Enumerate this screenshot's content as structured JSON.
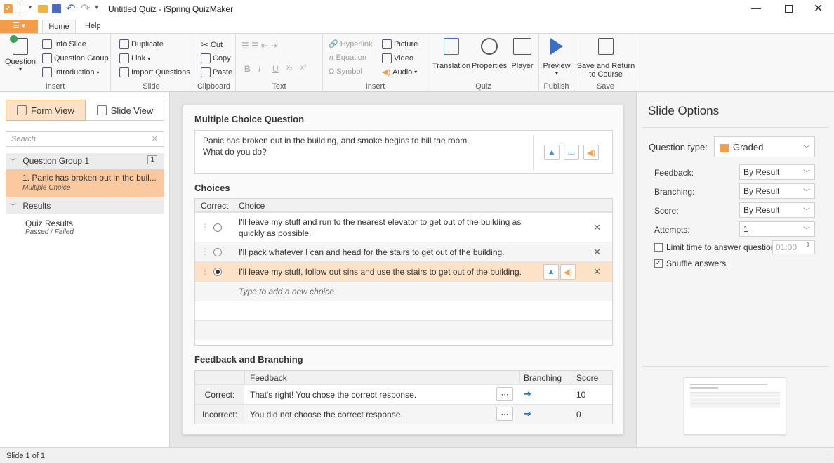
{
  "window": {
    "title": "Untitled Quiz - iSpring QuizMaker"
  },
  "ribbon_tabs": {
    "file_menu": "☰ ▾",
    "home": "Home",
    "help": "Help"
  },
  "ribbon": {
    "insert": {
      "question": "Question",
      "info_slide": "Info Slide",
      "question_group": "Question Group",
      "introduction": "Introduction",
      "label": "Insert"
    },
    "slide": {
      "duplicate": "Duplicate",
      "link": "Link",
      "import_questions": "Import Questions",
      "label": "Slide"
    },
    "clipboard": {
      "cut": "Cut",
      "copy": "Copy",
      "paste": "Paste",
      "label": "Clipboard"
    },
    "text": {
      "label": "Text"
    },
    "insert2": {
      "hyperlink": "Hyperlink",
      "equation": "Equation",
      "symbol": "Symbol",
      "picture": "Picture",
      "video": "Video",
      "audio": "Audio",
      "label": "Insert"
    },
    "quiz": {
      "translation": "Translation",
      "properties": "Properties",
      "player": "Player",
      "label": "Quiz"
    },
    "publish": {
      "preview": "Preview",
      "label": "Publish"
    },
    "save": {
      "save_return": "Save and Return",
      "to_course": "to Course",
      "label": "Save"
    }
  },
  "left": {
    "form_view": "Form View",
    "slide_view": "Slide View",
    "search_placeholder": "Search",
    "group": {
      "title": "Question Group 1",
      "count": "1"
    },
    "question": {
      "title": "1. Panic has broken out in the buil...",
      "type": "Multiple Choice"
    },
    "results_header": "Results",
    "quiz_results": {
      "title": "Quiz Results",
      "sub": "Passed / Failed"
    }
  },
  "question": {
    "section_title": "Multiple Choice Question",
    "text_line1": "Panic has broken out in the building, and smoke begins to hill the room.",
    "text_line2": "What do you do?"
  },
  "choices": {
    "section_title": "Choices",
    "col_correct": "Correct",
    "col_choice": "Choice",
    "items": [
      {
        "line1": "I'll leave my stuff and run to the nearest elevator to get out of the building as",
        "line2": "quickly as possible.",
        "selected": false
      },
      {
        "line1": "I'll pack whatever I can and head for the stairs to get out of the building.",
        "line2": "",
        "selected": false
      },
      {
        "line1": "I'll leave my stuff, follow out sins and use the stairs to get out of the building.",
        "line2": "",
        "selected": true
      }
    ],
    "add_placeholder": "Type to add a new choice"
  },
  "feedback": {
    "section_title": "Feedback and Branching",
    "col_feedback": "Feedback",
    "col_branching": "Branching",
    "col_score": "Score",
    "rows": [
      {
        "label": "Correct:",
        "text": "That's right! You chose the correct response.",
        "score": "10"
      },
      {
        "label": "Incorrect:",
        "text": "You did not choose the correct response.",
        "score": "0"
      }
    ]
  },
  "slide_options": {
    "title": "Slide Options",
    "question_type_label": "Question type:",
    "question_type_value": "Graded",
    "feedback_label": "Feedback:",
    "feedback_value": "By Result",
    "branching_label": "Branching:",
    "branching_value": "By Result",
    "score_label": "Score:",
    "score_value": "By Result",
    "attempts_label": "Attempts:",
    "attempts_value": "1",
    "limit_time_label": "Limit time to answer question:",
    "limit_time_value": "01:00",
    "shuffle_label": "Shuffle answers"
  },
  "status": {
    "slide": "Slide 1 of 1"
  },
  "colors": {
    "accent": "#f39c4a",
    "selected_bg": "#fde2c8",
    "link_blue": "#1a6fc6"
  }
}
